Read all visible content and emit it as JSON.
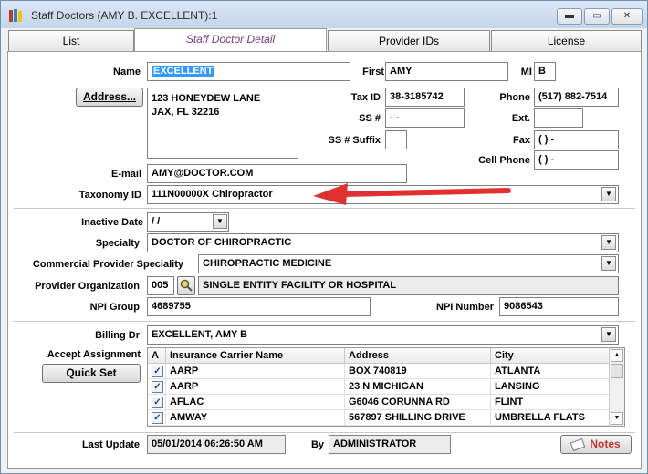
{
  "window": {
    "title": "Staff Doctors (AMY B. EXCELLENT):1",
    "minimize": "▬",
    "maximize": "▭",
    "close": "✕"
  },
  "tabs": [
    {
      "label": "List"
    },
    {
      "label": "Staff Doctor Detail"
    },
    {
      "label": "Provider IDs"
    },
    {
      "label": "License"
    }
  ],
  "form": {
    "name_label": "Name",
    "name": "EXCELLENT",
    "first_label": "First",
    "first": "AMY",
    "mi_label": "MI",
    "mi": "B",
    "address_button": "Address...",
    "address_line1": "123 HONEYDEW LANE",
    "address_line2": "JAX, FL 32216",
    "taxid_label": "Tax ID",
    "taxid": "38-3185742",
    "ssn_label": "SS #",
    "ssn": "  -  -",
    "ssn_suffix_label": "SS # Suffix",
    "ssn_suffix": "",
    "phone_label": "Phone",
    "phone": "(517) 882-7514",
    "ext_label": "Ext.",
    "ext": "",
    "fax_label": "Fax",
    "fax": "(   )    -",
    "cell_label": "Cell Phone",
    "cell": "(   )    -",
    "email_label": "E-mail",
    "email": "AMY@DOCTOR.COM",
    "taxonomy_label": "Taxonomy ID",
    "taxonomy": "111N00000X Chiropractor",
    "inactive_label": "Inactive Date",
    "inactive": " / /",
    "specialty_label": "Specialty",
    "specialty": "DOCTOR OF CHIROPRACTIC",
    "comm_specialty_label": "Commercial Provider Speciality",
    "comm_specialty": "CHIROPRACTIC MEDICINE",
    "prov_org_label": "Provider Organization",
    "prov_org_code": "005",
    "prov_org": "SINGLE ENTITY FACILITY OR HOSPITAL",
    "npi_group_label": "NPI Group",
    "npi_group": "4689755",
    "npi_number_label": "NPI Number",
    "npi_number": "9086543",
    "billing_label": "Billing Dr",
    "billing": "EXCELLENT, AMY B",
    "accept_label": "Accept Assignment",
    "quickset_button": "Quick Set",
    "last_update_label": "Last Update",
    "last_update": "05/01/2014 06:26:50 AM",
    "by_label": "By",
    "by": "ADMINISTRATOR",
    "notes_button": "Notes"
  },
  "grid": {
    "headers": [
      "A",
      "Insurance Carrier Name",
      "Address",
      "City"
    ],
    "rows": [
      {
        "check": "✓",
        "name": "AARP",
        "address": "BOX 740819",
        "city": "ATLANTA"
      },
      {
        "check": "✓",
        "name": "AARP",
        "address": "23 N MICHIGAN",
        "city": "LANSING"
      },
      {
        "check": "✓",
        "name": "AFLAC",
        "address": "G6046 CORUNNA RD",
        "city": "FLINT"
      },
      {
        "check": "✓",
        "name": "AMWAY",
        "address": "567897 SHILLING DRIVE",
        "city": "UMBRELLA FLATS"
      }
    ]
  },
  "colors": {
    "annotation_arrow": "#e03030",
    "highlight": "#3399ff"
  }
}
